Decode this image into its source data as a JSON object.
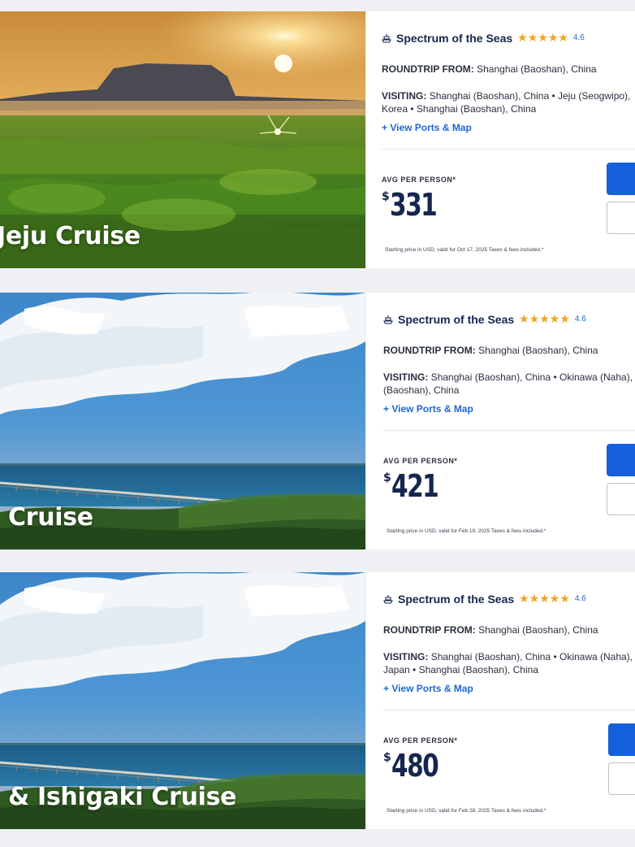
{
  "cards": [
    {
      "title": "Jeju Cruise",
      "ship": "Spectrum of the Seas",
      "stars": "★★★★★",
      "rating": "4.6",
      "roundtrip_label": "ROUNDTRIP FROM:",
      "roundtrip_value": "Shanghai (Baoshan), China",
      "visiting_label": "VISITING:",
      "visiting_line1": "Shanghai (Baoshan), China • Jeju (Seogwipo),",
      "visiting_line2": "Korea • Shanghai (Baoshan), China",
      "ports_link": "+ View Ports & Map",
      "avg_label": "AVG PER PERSON*",
      "currency": "$",
      "price": "331",
      "fineprint": "Starting price in USD, valid for Oct 17, 2025 Taxes & fees included.*"
    },
    {
      "title": "Cruise",
      "ship": "Spectrum of the Seas",
      "stars": "★★★★★",
      "rating": "4.6",
      "roundtrip_label": "ROUNDTRIP FROM:",
      "roundtrip_value": "Shanghai (Baoshan), China",
      "visiting_label": "VISITING:",
      "visiting_line1": "Shanghai (Baoshan), China • Okinawa (Naha),",
      "visiting_line2": "(Baoshan), China",
      "ports_link": "+ View Ports & Map",
      "avg_label": "AVG PER PERSON*",
      "currency": "$",
      "price": "421",
      "fineprint": "Starting price in USD, valid for Feb 19, 2025 Taxes & fees included.*"
    },
    {
      "title": "& Ishigaki Cruise",
      "ship": "Spectrum of the Seas",
      "stars": "★★★★★",
      "rating": "4.6",
      "roundtrip_label": "ROUNDTRIP FROM:",
      "roundtrip_value": "Shanghai (Baoshan), China",
      "visiting_label": "VISITING:",
      "visiting_line1": "Shanghai (Baoshan), China • Okinawa (Naha),",
      "visiting_line2": "Japan • Shanghai (Baoshan), China",
      "ports_link": "+ View Ports & Map",
      "avg_label": "AVG PER PERSON*",
      "currency": "$",
      "price": "480",
      "fineprint": "Starting price in USD, valid for Feb 28, 2025 Taxes & fees included.*"
    }
  ],
  "colors": {
    "accent": "#1560dd",
    "link": "#1f66d6",
    "star": "#f2a31d",
    "navy": "#15264f",
    "page_bg": "#eef0f3"
  },
  "icons": {
    "ship": "ship-icon",
    "star": "star-icon"
  }
}
